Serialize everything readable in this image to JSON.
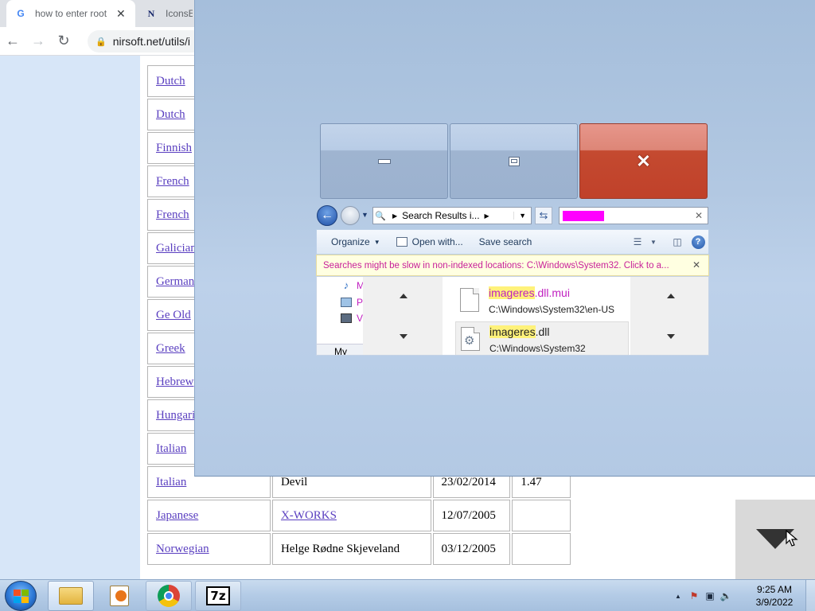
{
  "browser": {
    "tabs": [
      {
        "title": "how to enter root",
        "favicon": "G"
      },
      {
        "title": "IconsExtract",
        "favicon": "N"
      }
    ],
    "url": "nirsoft.net/utils/i",
    "table_rows": [
      {
        "lang": "Dutch",
        "author": "",
        "date": "",
        "version": ""
      },
      {
        "lang": "Dutch",
        "author": "",
        "date": "",
        "version": ""
      },
      {
        "lang": "Finnish",
        "author": "",
        "date": "",
        "version": ""
      },
      {
        "lang": "French",
        "author": "",
        "date": "",
        "version": ""
      },
      {
        "lang": "French",
        "author": "",
        "date": "",
        "version": ""
      },
      {
        "lang": "Galician",
        "author": "",
        "date": "",
        "version": ""
      },
      {
        "lang": "German",
        "author": "",
        "date": "",
        "version": ""
      },
      {
        "lang": "Ge Old",
        "author": "",
        "date": "",
        "version": ""
      },
      {
        "lang": "Greek",
        "author": "",
        "date": "",
        "version": ""
      },
      {
        "lang": "Hebrew",
        "author": "",
        "date": "",
        "version": ""
      },
      {
        "lang": "Hungarian",
        "author": "",
        "date": "",
        "version": ""
      },
      {
        "lang": "Italian",
        "author": "",
        "date": "",
        "version": ""
      },
      {
        "lang": "Italian",
        "author": "Devil",
        "date": "23/02/2014",
        "version": "1.47"
      },
      {
        "lang": "Japanese",
        "author": "X-WORKS",
        "date": "12/07/2005",
        "version": ""
      },
      {
        "lang": "Norwegian",
        "author": "Helge Rødne Skjeveland",
        "date": "03/12/2005",
        "version": ""
      }
    ]
  },
  "explorer": {
    "address": "Search Results i...",
    "commands": {
      "organize": "Organize",
      "open_with": "Open with...",
      "save_search": "Save search"
    },
    "infobar": "Searches might be slow in non-indexed locations: C:\\Windows\\System32. Click to a...",
    "nav_items": [
      "M",
      "P",
      "V"
    ],
    "nav_computer": "My",
    "results": [
      {
        "name_highlight": "imageres",
        "name_rest": ".dll.mui",
        "path": "C:\\Windows\\System32\\en-US",
        "selected": false
      },
      {
        "name_highlight": "imageres",
        "name_rest": ".dll",
        "path": "C:\\Windows\\System32",
        "selected": true
      }
    ]
  },
  "taskbar": {
    "apps": [
      "windows-explorer",
      "media-center",
      "chrome",
      "7-zip"
    ],
    "sevenzip_label": "7z",
    "time": "9:25 AM",
    "date": "3/9/2022"
  },
  "colors": {
    "search_highlight": "#ff00ff",
    "close_button": "#c0412a",
    "link": "#5a3fc0"
  }
}
